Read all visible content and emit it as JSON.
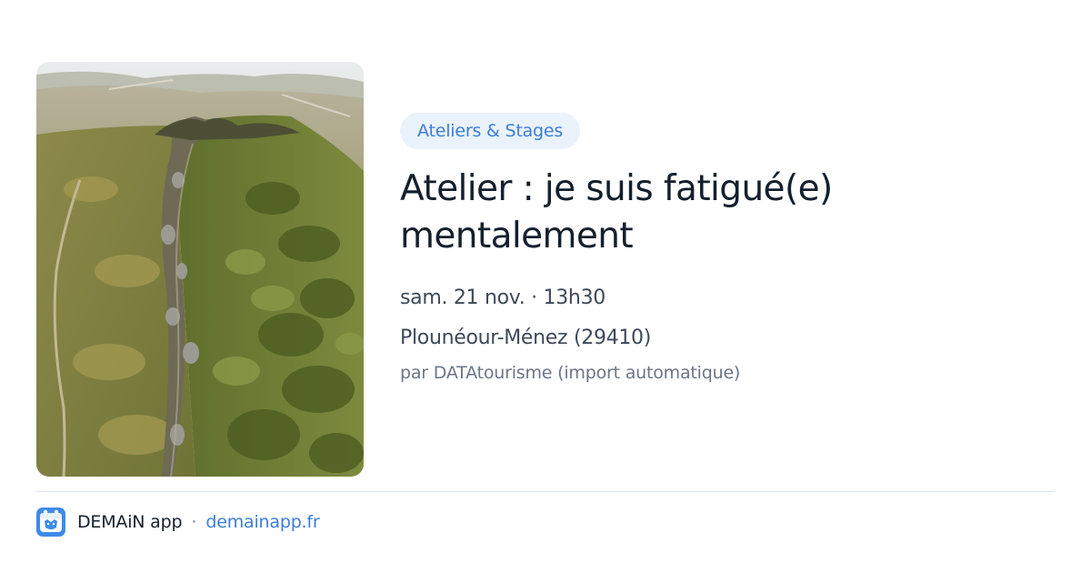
{
  "card": {
    "category": "Ateliers & Stages",
    "title": "Atelier : je suis fatigué(e) mentalement",
    "date_time": "sam. 21 nov. · 13h30",
    "location": "Plounéour-Ménez (29410)",
    "source": "par DATAtourisme (import automatique)"
  },
  "footer": {
    "app_name": "DEMAiN app",
    "separator": "·",
    "link_text": "demainapp.fr"
  },
  "colors": {
    "accent": "#3d7ed6",
    "pill_bg": "#eaf2fc",
    "title": "#14202e",
    "meta": "#3d4a5a",
    "muted": "#6a7686"
  },
  "icons": {
    "hero_image": "mountain-ridge-photo",
    "app_logo": "demain-app-logo-icon"
  }
}
